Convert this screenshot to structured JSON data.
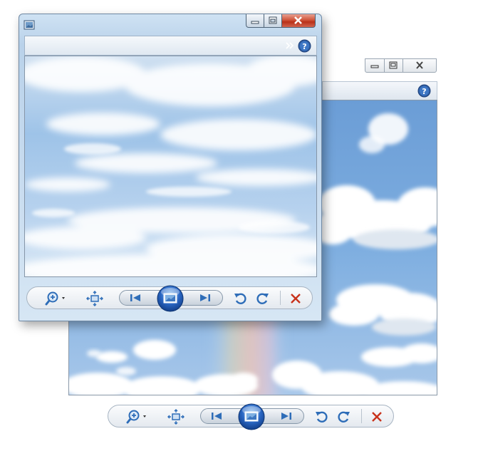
{
  "back_window": {
    "caption_buttons": [
      "minimize",
      "maximize",
      "close"
    ],
    "help_icon": "help-icon",
    "image": "sky-clouds-rainbow"
  },
  "front_window": {
    "title_icon": "photo-viewer-icon",
    "caption_buttons": [
      "minimize",
      "maximize",
      "close"
    ],
    "command_bar": {
      "overflow_icon": "chevron-double-right-icon",
      "help_icon": "help-icon"
    },
    "image": "sky-clouds"
  },
  "toolbar": {
    "buttons": [
      {
        "name": "zoom-button",
        "icon": "zoom-in-icon",
        "has_dropdown": true
      },
      {
        "name": "actual-size-button",
        "icon": "fit-window-icon"
      },
      {
        "name": "previous-button",
        "icon": "previous-icon"
      },
      {
        "name": "slideshow-button",
        "icon": "slideshow-icon"
      },
      {
        "name": "next-button",
        "icon": "next-icon"
      },
      {
        "name": "rotate-counterclockwise-button",
        "icon": "rotate-left-icon"
      },
      {
        "name": "rotate-clockwise-button",
        "icon": "rotate-right-icon"
      },
      {
        "name": "delete-button",
        "icon": "delete-icon"
      }
    ]
  },
  "colors": {
    "accent_blue": "#2e6db8",
    "delete_red": "#c8321b",
    "close_button_red": "#c33a22",
    "sky_blue": "#7faee0"
  }
}
